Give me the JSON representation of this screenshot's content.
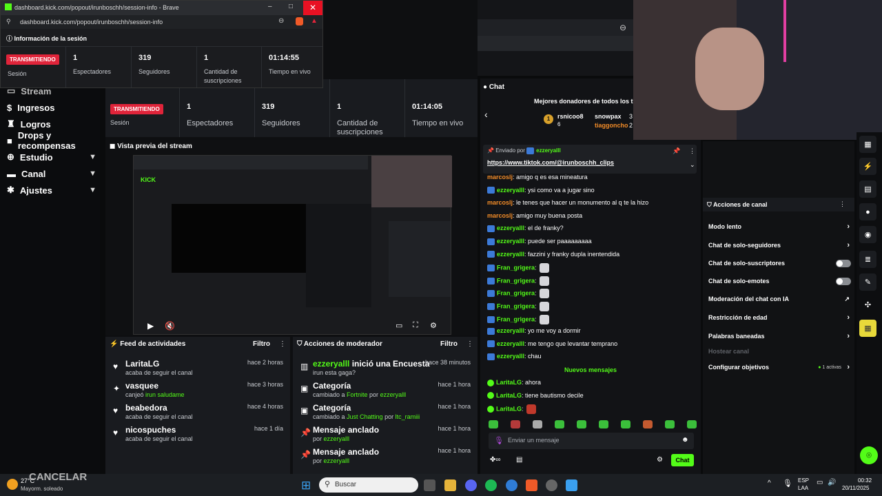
{
  "popup": {
    "url_title": "dashboard.kick.com/popout/irunboschh/session-info - Brave",
    "address": "dashboard.kick.com/popout/irunboschh/session-info",
    "header": "Información de la sesión",
    "live_badge": "TRANSMITIENDO",
    "session_label": "Sesión",
    "stats": [
      {
        "value": "1",
        "label": "Espectadores"
      },
      {
        "value": "319",
        "label": "Seguidores"
      },
      {
        "value": "1",
        "label": "Cantidad de suscripciones"
      },
      {
        "value": "01:14:55",
        "label": "Tiempo en vivo"
      }
    ]
  },
  "sidebar": {
    "items": [
      {
        "label": "Stream",
        "icon": "stream-icon"
      },
      {
        "label": "Ingresos",
        "icon": "money-icon"
      },
      {
        "label": "Logros",
        "icon": "trophy-icon"
      },
      {
        "label": "Drops y recompensas",
        "icon": "gift-icon"
      },
      {
        "label": "Estudio",
        "icon": "studio-icon"
      },
      {
        "label": "Canal",
        "icon": "channel-icon"
      },
      {
        "label": "Ajustes",
        "icon": "gear-icon"
      }
    ]
  },
  "session": {
    "live_badge": "TRANSMITIENDO",
    "session_label": "Sesión",
    "stats": [
      {
        "value": "1",
        "label": "Espectadores"
      },
      {
        "value": "319",
        "label": "Seguidores"
      },
      {
        "value": "1",
        "label": "Cantidad de suscripciones"
      },
      {
        "value": "01:14:05",
        "label": "Tiempo en vivo"
      }
    ]
  },
  "preview": {
    "title": "Vista previa del stream"
  },
  "activity": {
    "title": "Feed de actividades",
    "filter": "Filtro",
    "items": [
      {
        "name": "LaritaLG",
        "sub": "acaba de seguir el canal",
        "time": "hace 2 horas",
        "icon": "heart-icon"
      },
      {
        "name": "vasquee",
        "sub_pre": "canjeó ",
        "sub_hl": "irun saludame",
        "time": "hace 3 horas",
        "icon": "redeem-icon"
      },
      {
        "name": "beabedora",
        "sub": "acaba de seguir el canal",
        "time": "hace 4 horas",
        "icon": "heart-icon"
      },
      {
        "name": "nicospuches",
        "sub": "acaba de seguir el canal",
        "time": "hace 1 día",
        "icon": "heart-icon"
      }
    ]
  },
  "modactions": {
    "title": "Acciones de moderador",
    "filter": "Filtro",
    "items": [
      {
        "name_hl": "ezzeryalll",
        "name_rest": " inició una Encuesta",
        "sub": "irun esta gaga?",
        "time": "hace 38 minutos",
        "icon": "poll-icon"
      },
      {
        "name": "Categoría",
        "sub_pre": "cambiado a ",
        "sub_hl": "Fortnite",
        "sub_mid": " por ",
        "sub_hl2": "ezzeryalll",
        "time": "hace 1 hora",
        "icon": "category-icon"
      },
      {
        "name": "Categoría",
        "sub_pre": "cambiado a ",
        "sub_hl": "Just Chatting",
        "sub_mid": " por ",
        "sub_hl2": "ltc_ramiii",
        "time": "hace 1 hora",
        "icon": "category-icon"
      },
      {
        "name": "Mensaje anclado",
        "sub_pre": "por ",
        "sub_hl": "ezzeryalll",
        "time": "hace 1 hora",
        "icon": "pin-icon"
      },
      {
        "name": "Mensaje anclado",
        "sub_pre": "por ",
        "sub_hl": "ezzeryalll",
        "time": "hace 1 hora",
        "icon": "pin-icon"
      }
    ]
  },
  "chat": {
    "title": "Chat",
    "donors_title": "Mejores donadores de todos los tie",
    "donors": [
      {
        "rank": "1",
        "name": "rsnicoo8",
        "amount": "6"
      },
      {
        "name": "snowpax",
        "amount": "3"
      },
      {
        "name": "tiaggoncho",
        "amount": "2"
      }
    ],
    "pinned_by_label": "Enviado por",
    "pinned_by": "ezzeryalll",
    "pinned_link": "https://www.tiktok.com/@irunboschh_clips",
    "messages": [
      {
        "user": "marcoslj",
        "text": "amigo q es esa mineatura",
        "cls": "mc",
        "badge": false
      },
      {
        "user": "ezzeryalll",
        "text": "ysi como va a jugar sino",
        "cls": "ez",
        "badge": true
      },
      {
        "user": "marcoslj",
        "text": "le tenes que hacer un monumento al q te la hizo",
        "cls": "mc",
        "badge": false
      },
      {
        "user": "marcoslj",
        "text": "amigo muy buena posta",
        "cls": "mc",
        "badge": false
      },
      {
        "user": "ezzeryalll",
        "text": "el de franky?",
        "cls": "ez",
        "badge": true
      },
      {
        "user": "ezzeryalll",
        "text": "puede ser paaaaaaaaa",
        "cls": "ez",
        "badge": true
      },
      {
        "user": "ezzeryalll",
        "text": "fazzini y franky dupla inentendida",
        "cls": "ez",
        "badge": true
      },
      {
        "user": "Fran_grigera",
        "text": "",
        "cls": "fr",
        "badge": true,
        "emote": true
      },
      {
        "user": "Fran_grigera",
        "text": "",
        "cls": "fr",
        "badge": true,
        "emote": true
      },
      {
        "user": "Fran_grigera",
        "text": "",
        "cls": "fr",
        "badge": true,
        "emote": true
      },
      {
        "user": "Fran_grigera",
        "text": "",
        "cls": "fr",
        "badge": true,
        "emote": true
      },
      {
        "user": "Fran_grigera",
        "text": "",
        "cls": "fr",
        "badge": true,
        "emote": true
      },
      {
        "user": "ezzeryalll",
        "text": "yo me voy a dormir",
        "cls": "ez",
        "badge": true
      },
      {
        "user": "ezzeryalll",
        "text": "me tengo que levantar temprano",
        "cls": "ez",
        "badge": true
      },
      {
        "user": "ezzeryalll",
        "text": "chau",
        "cls": "ez",
        "badge": true
      }
    ],
    "new_messages": "Nuevos mensajes",
    "new": [
      {
        "user": "LaritaLG",
        "text": "ahora"
      },
      {
        "user": "LaritaLG",
        "text": "tiene bautismo decile"
      },
      {
        "user": "LaritaLG",
        "text": "",
        "emote": true
      }
    ],
    "input_placeholder": "Enviar un mensaje",
    "send": "Chat"
  },
  "channel_actions": {
    "title": "Acciones de canal",
    "items": [
      {
        "label": "Modo lento",
        "control": "arrow"
      },
      {
        "label": "Chat de solo-seguidores",
        "control": "arrow"
      },
      {
        "label": "Chat de solo-suscriptores",
        "control": "toggle"
      },
      {
        "label": "Chat de solo-emotes",
        "control": "toggle"
      },
      {
        "label": "Moderación del chat con IA",
        "control": "external"
      },
      {
        "label": "Restricción de edad",
        "control": "arrow"
      },
      {
        "label": "Palabras baneadas",
        "control": "arrow"
      },
      {
        "label": "Hostear canal",
        "control": "none",
        "disabled": true
      },
      {
        "label": "Configurar objetivos",
        "control": "arrow",
        "extra": "1 activas"
      }
    ]
  },
  "taskbar": {
    "weather_temp": "27°C",
    "weather_desc": "Mayorm. soleado",
    "cancel_overlay": "CANCELAR",
    "search": "Buscar",
    "lang_top": "ESP",
    "lang_bottom": "LAA",
    "time": "00:32",
    "date": "20/11/2025"
  },
  "colors": {
    "accent": "#53fc18",
    "live": "#e0243a",
    "panel": "#191b1f"
  }
}
